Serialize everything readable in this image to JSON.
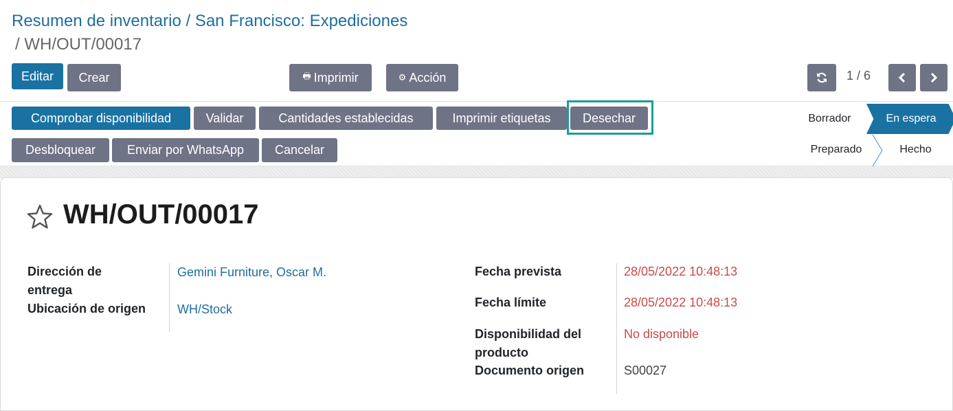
{
  "breadcrumb": {
    "items": [
      "Resumen de inventario",
      "San Francisco: Expediciones"
    ],
    "current": "WH/OUT/00017",
    "separator": "/"
  },
  "toolbar": {
    "edit_label": "Editar",
    "create_label": "Crear",
    "print_label": "Imprimir",
    "action_label": "Acción"
  },
  "pager": {
    "value": "1 / 6"
  },
  "actions": {
    "check_availability": "Comprobar disponibilidad",
    "validate": "Validar",
    "set_quantities": "Cantidades establecidas",
    "print_labels": "Imprimir etiquetas",
    "scrap": "Desechar",
    "unlock": "Desbloquear",
    "whatsapp": "Enviar por WhatsApp",
    "cancel": "Cancelar"
  },
  "status": {
    "stages": [
      "Borrador",
      "En espera",
      "Preparado",
      "Hecho"
    ],
    "active": "En espera"
  },
  "record": {
    "name": "WH/OUT/00017",
    "delivery_address_label_1": "Dirección de",
    "delivery_address_label_2": "entrega",
    "delivery_address": "Gemini Furniture, Oscar M.",
    "source_location_label": "Ubicación de origen",
    "source_location": "WH/Stock",
    "scheduled_date_label": "Fecha prevista",
    "scheduled_date": "28/05/2022 10:48:13",
    "deadline_label": "Fecha límite",
    "deadline": "28/05/2022 10:48:13",
    "availability_label_1": "Disponibilidad del",
    "availability_label_2": "producto",
    "availability": "No disponible",
    "origin_label": "Documento origen",
    "origin": "S00027"
  },
  "colors": {
    "primary": "#1a72a3",
    "secondary": "#6f7386",
    "link": "#1f6e9e",
    "danger": "#c94a4a",
    "highlight": "#1a9e96"
  }
}
